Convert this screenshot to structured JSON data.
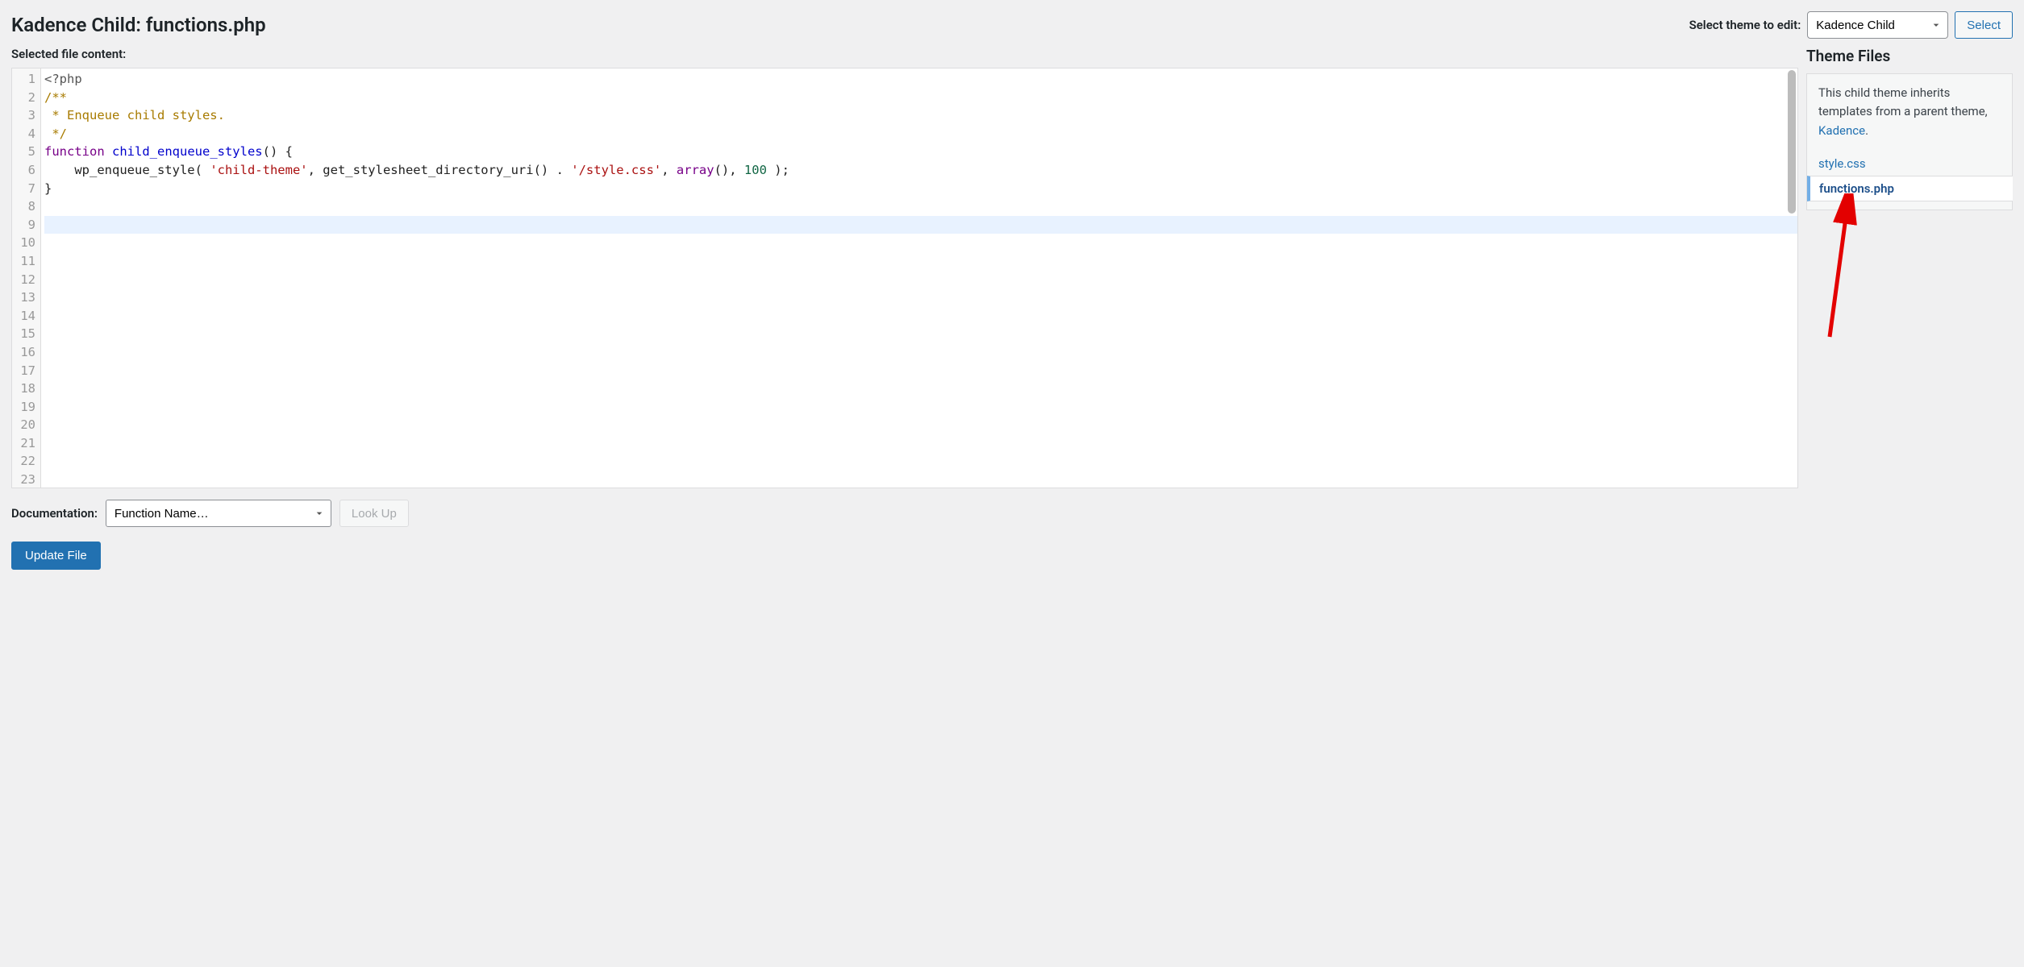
{
  "header": {
    "title": "Kadence Child: functions.php",
    "select_label": "Select theme to edit:",
    "theme_selected": "Kadence Child",
    "select_button": "Select"
  },
  "editor": {
    "content_label": "Selected file content:",
    "active_line": 9,
    "total_lines": 23,
    "code_lines": [
      [
        {
          "t": "<?php",
          "c": "meta"
        }
      ],
      [
        {
          "t": "/**",
          "c": "comment"
        }
      ],
      [
        {
          "t": " * Enqueue child styles.",
          "c": "comment"
        }
      ],
      [
        {
          "t": " */",
          "c": "comment"
        }
      ],
      [
        {
          "t": "function",
          "c": "keyword"
        },
        {
          "t": " ",
          "c": "var"
        },
        {
          "t": "child_enqueue_styles",
          "c": "def"
        },
        {
          "t": "() {",
          "c": "punct"
        }
      ],
      [
        {
          "t": "    wp_enqueue_style( ",
          "c": "var"
        },
        {
          "t": "'child-theme'",
          "c": "string"
        },
        {
          "t": ", get_stylesheet_directory_uri() . ",
          "c": "var"
        },
        {
          "t": "'/style.css'",
          "c": "string"
        },
        {
          "t": ", ",
          "c": "var"
        },
        {
          "t": "array",
          "c": "keyword"
        },
        {
          "t": "(), ",
          "c": "var"
        },
        {
          "t": "100",
          "c": "number"
        },
        {
          "t": " );",
          "c": "var"
        }
      ],
      [
        {
          "t": "}",
          "c": "punct"
        }
      ],
      [],
      [],
      [],
      [],
      [],
      [],
      [],
      [],
      [],
      [],
      [],
      [],
      [],
      [],
      [],
      []
    ]
  },
  "sidebar": {
    "title": "Theme Files",
    "note_prefix": "This child theme inherits templates from a parent theme, ",
    "note_link": "Kadence",
    "note_suffix": ".",
    "files": [
      {
        "name": "style.css",
        "active": false
      },
      {
        "name": "functions.php",
        "active": true
      }
    ]
  },
  "footer": {
    "doc_label": "Documentation:",
    "doc_selected": "Function Name…",
    "lookup_button": "Look Up",
    "update_button": "Update File"
  },
  "colors": {
    "link": "#2271b1",
    "annotation": "#e30000"
  }
}
